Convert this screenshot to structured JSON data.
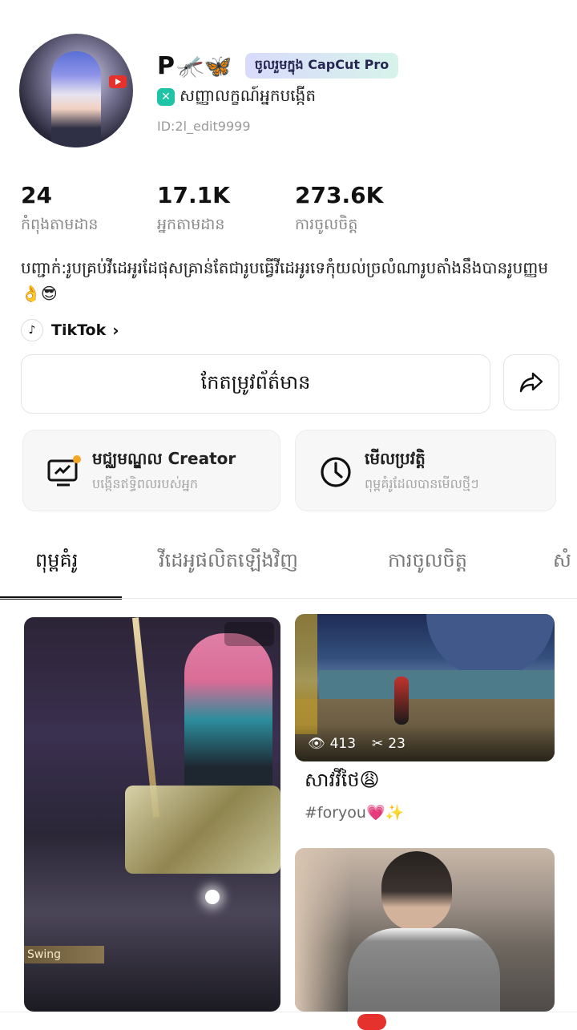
{
  "profile": {
    "name": "P",
    "name_emojis": "🦟🦋",
    "pro_badge": "ចូលរួមក្នុង CapCut Pro",
    "creator_label": "សញ្ញាលក្ខណ៍អ្នកបង្កើត",
    "creator_icon": "capcut-logo-icon",
    "user_id": "ID:2l_edit9999"
  },
  "stats": [
    {
      "value": "24",
      "label": "កំពុងតាមដាន"
    },
    {
      "value": "17.1K",
      "label": "អ្នកតាមដាន"
    },
    {
      "value": "273.6K",
      "label": "ការចូលចិត្ត"
    }
  ],
  "bio": "បញ្ជាក់:រូបគ្រប់វីដេអូរដែផុសគ្រាន់តែជារូបធ្វើវីដេអូរទេកុំយល់ច្រលំណារូបតាំងនឹងបានរូបញ្ញម 👌😎",
  "tiktok": {
    "label": "TikTok",
    "chevron": "›"
  },
  "buttons": {
    "edit_profile": "កែតម្រូវព័ត៌មាន",
    "share_icon": "share-arrow-icon"
  },
  "cards": [
    {
      "title": "មជ្ឈមណ្ឌល Creator",
      "subtitle": "បង្កើនឥទ្ធិពលរបស់អ្នក",
      "icon": "monitor-chart-icon"
    },
    {
      "title": "មើលប្រវត្តិ",
      "subtitle": "ពុម្ពគំរូដែលបានមើលថ្មីៗ",
      "icon": "clock-icon"
    }
  ],
  "tabs": [
    "ពុម្ពគំរូ",
    "វីដេអូផលិតឡើងវិញ",
    "ការចូលចិត្ត",
    "សំ"
  ],
  "active_tab": 0,
  "grid": {
    "item1_tag": "Swing",
    "item2": {
      "views": "413",
      "uses": "23",
      "title": "សាវវីថៃ😩",
      "tags": "#foryou💗✨"
    }
  },
  "colors": {
    "accent": "#111111",
    "badge_gradient_start": "#d8dbfb",
    "badge_gradient_end": "#d7f3ea",
    "creator_icon": "#1fc3a6"
  }
}
